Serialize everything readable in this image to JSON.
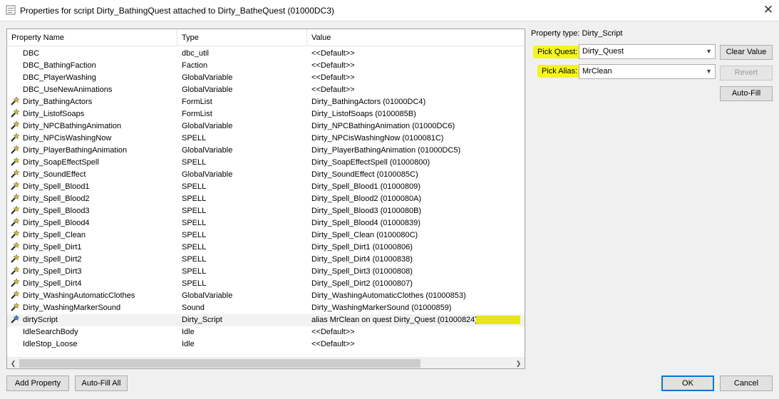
{
  "window": {
    "title": "Properties for script Dirty_BathingQuest attached to Dirty_BatheQuest (01000DC3)",
    "close_glyph": "✕"
  },
  "table": {
    "columns": [
      "Property Name",
      "Type",
      "Value"
    ],
    "rows": [
      {
        "name": "DBC",
        "type": "dbc_util",
        "value": "<<Default>>",
        "icon": ""
      },
      {
        "name": "DBC_BathingFaction",
        "type": "Faction",
        "value": "<<Default>>",
        "icon": ""
      },
      {
        "name": "DBC_PlayerWashing",
        "type": "GlobalVariable",
        "value": "<<Default>>",
        "icon": ""
      },
      {
        "name": "DBC_UseNewAnimations",
        "type": "GlobalVariable",
        "value": "<<Default>>",
        "icon": ""
      },
      {
        "name": "Dirty_BathingActors",
        "type": "FormList",
        "value": "Dirty_BathingActors (01000DC4)",
        "icon": "wand-icon"
      },
      {
        "name": "Dirty_ListofSoaps",
        "type": "FormList",
        "value": "Dirty_ListofSoaps (0100085B)",
        "icon": "wand-icon"
      },
      {
        "name": "Dirty_NPCBathingAnimation",
        "type": "GlobalVariable",
        "value": "Dirty_NPCBathingAnimation (01000DC6)",
        "icon": "wand-icon"
      },
      {
        "name": "Dirty_NPCisWashingNow",
        "type": "SPELL",
        "value": "Dirty_NPCisWashingNow (0100081C)",
        "icon": "wand-icon"
      },
      {
        "name": "Dirty_PlayerBathingAnimation",
        "type": "GlobalVariable",
        "value": "Dirty_PlayerBathingAnimation (01000DC5)",
        "icon": "wand-icon"
      },
      {
        "name": "Dirty_SoapEffectSpell",
        "type": "SPELL",
        "value": "Dirty_SoapEffectSpell (01000800)",
        "icon": "wand-icon"
      },
      {
        "name": "Dirty_SoundEffect",
        "type": "GlobalVariable",
        "value": "Dirty_SoundEffect (0100085C)",
        "icon": "wand-icon"
      },
      {
        "name": "Dirty_Spell_Blood1",
        "type": "SPELL",
        "value": "Dirty_Spell_Blood1 (01000809)",
        "icon": "wand-icon"
      },
      {
        "name": "Dirty_Spell_Blood2",
        "type": "SPELL",
        "value": "Dirty_Spell_Blood2 (0100080A)",
        "icon": "wand-icon"
      },
      {
        "name": "Dirty_Spell_Blood3",
        "type": "SPELL",
        "value": "Dirty_Spell_Blood3 (0100080B)",
        "icon": "wand-icon"
      },
      {
        "name": "Dirty_Spell_Blood4",
        "type": "SPELL",
        "value": "Dirty_Spell_Blood4 (01000839)",
        "icon": "wand-icon"
      },
      {
        "name": "Dirty_Spell_Clean",
        "type": "SPELL",
        "value": "Dirty_Spell_Clean (0100080C)",
        "icon": "wand-icon"
      },
      {
        "name": "Dirty_Spell_Dirt1",
        "type": "SPELL",
        "value": "Dirty_Spell_Dirt1 (01000806)",
        "icon": "wand-icon"
      },
      {
        "name": "Dirty_Spell_Dirt2",
        "type": "SPELL",
        "value": "Dirty_Spell_Dirt4 (01000838)",
        "icon": "wand-icon"
      },
      {
        "name": "Dirty_Spell_Dirt3",
        "type": "SPELL",
        "value": "Dirty_Spell_Dirt3 (01000808)",
        "icon": "wand-icon"
      },
      {
        "name": "Dirty_Spell_Dirt4",
        "type": "SPELL",
        "value": "Dirty_Spell_Dirt2 (01000807)",
        "icon": "wand-icon"
      },
      {
        "name": "Dirty_WashingAutomaticClothes",
        "type": "GlobalVariable",
        "value": "Dirty_WashingAutomaticClothes (01000853)",
        "icon": "wand-icon"
      },
      {
        "name": "Dirty_WashingMarkerSound",
        "type": "Sound",
        "value": "Dirty_WashingMarkerSound (01000859)",
        "icon": "wand-icon"
      },
      {
        "name": "dirtyScript",
        "type": "Dirty_Script",
        "value": "alias MrClean on quest Dirty_Quest (01000824)",
        "icon": "wand-blue-icon",
        "selected": true,
        "highlight": true
      },
      {
        "name": "IdleSearchBody",
        "type": "Idle",
        "value": "<<Default>>",
        "icon": ""
      },
      {
        "name": "IdleStop_Loose",
        "type": "Idle",
        "value": "<<Default>>",
        "icon": ""
      }
    ]
  },
  "side": {
    "property_type": "Property type: Dirty_Script",
    "pick_quest_label": "Pick Quest:",
    "pick_quest_value": "Dirty_Quest",
    "pick_alias_label": "Pick Alias:",
    "pick_alias_value": "MrClean",
    "clear_value": "Clear Value",
    "revert": "Revert",
    "auto_fill": "Auto-Fill"
  },
  "footer": {
    "add_property": "Add Property",
    "auto_fill_all": "Auto-Fill All",
    "ok": "OK",
    "cancel": "Cancel"
  },
  "colors": {
    "highlight": "#e6e619",
    "selection_row": "#f2f2f2",
    "ok_border": "#0078d7"
  }
}
